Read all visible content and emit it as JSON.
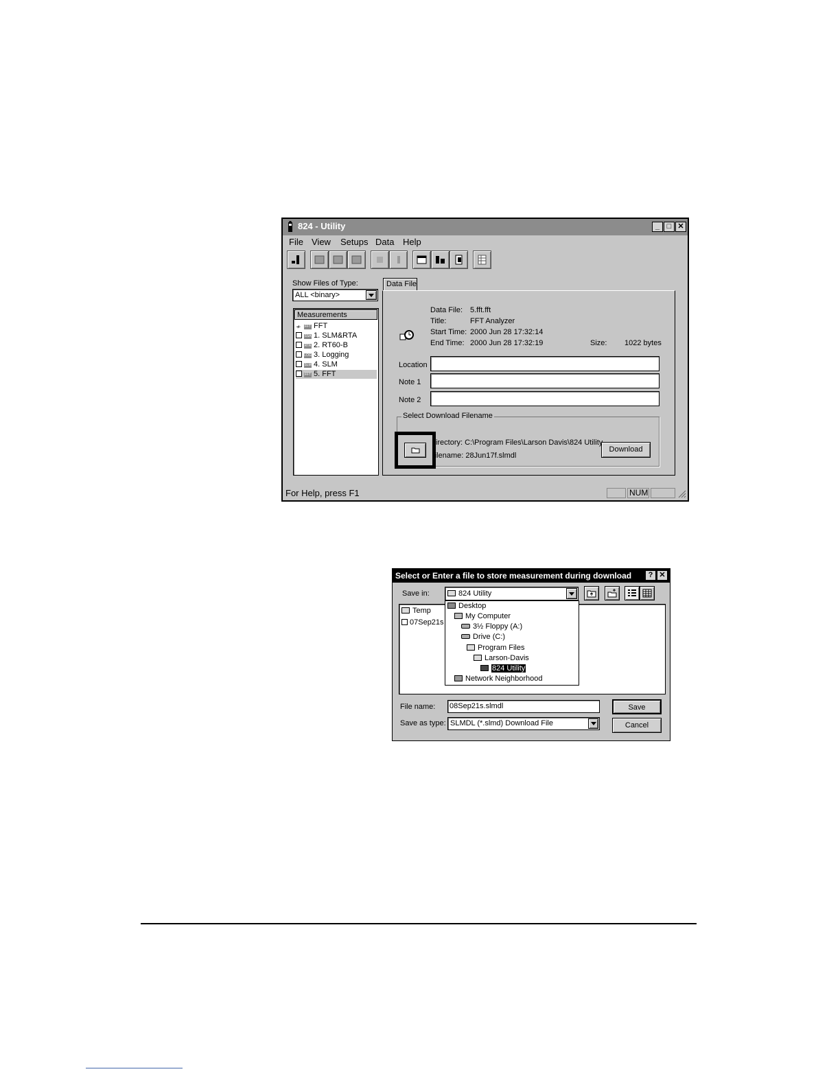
{
  "main_window": {
    "title": "824 - Utility",
    "menus": [
      "File",
      "View",
      "Setups",
      "Data",
      "Help"
    ],
    "show_files_label": "Show Files of Type:",
    "show_files_value": "ALL <binary>",
    "measurements_header": "Measurements",
    "measurements": [
      {
        "tag": "FFT",
        "label": "FFT"
      },
      {
        "tag": "SSA",
        "label": "1. SLM&RTA"
      },
      {
        "tag": "RTA",
        "label": "2. RT60-B"
      },
      {
        "tag": "LOG",
        "label": "3. Logging"
      },
      {
        "tag": "SLM",
        "label": "4. SLM"
      },
      {
        "tag": "FFT",
        "label": "5. FFT"
      }
    ],
    "tab_label": "Data File",
    "info": {
      "data_file_label": "Data File:",
      "data_file_value": "5.fft.fft",
      "title_label": "Title:",
      "title_value": "FFT Analyzer",
      "start_label": "Start Time:",
      "start_value": "2000 Jun 28 17:32:14",
      "end_label": "End Time:",
      "end_value": "2000 Jun 28 17:32:19",
      "size_label": "Size:",
      "size_value": "1022 bytes"
    },
    "location_label": "Location",
    "note1_label": "Note 1",
    "note2_label": "Note 2",
    "location_value": "",
    "note1_value": "",
    "note2_value": "",
    "group_label": "Select Download Filename",
    "directory_label": "Directory:",
    "directory_value": "C:\\Program Files\\Larson Davis\\824 Utility",
    "filename_label": "Filename:",
    "filename_value": "28Jun17f.slmdl",
    "download_label": "Download",
    "status_help": "For Help, press F1",
    "status_num": "NUM"
  },
  "save_dialog": {
    "title": "Select or Enter a file to store measurement during download",
    "save_in_label": "Save in:",
    "save_in_value": "824 Utility",
    "dropdown_items": [
      "Desktop",
      "My Computer",
      "3½ Floppy (A:)",
      "Drive (C:)",
      "Program Files",
      "Larson-Davis",
      "824 Utility",
      "Network Neighborhood"
    ],
    "files": [
      "Temp",
      "07Sep21s"
    ],
    "file_name_label": "File name:",
    "file_name_value": "08Sep21s.slmdl",
    "save_as_type_label": "Save as type:",
    "save_as_type_value": "SLMDL (*.slmd) Download File",
    "save_label": "Save",
    "cancel_label": "Cancel"
  }
}
